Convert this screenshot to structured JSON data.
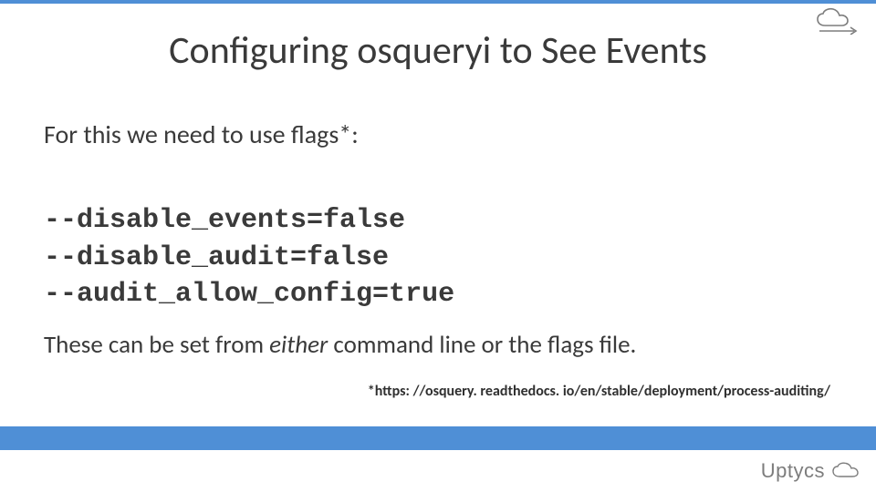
{
  "slide": {
    "title": "Configuring osqueryi to See Events",
    "intro": "For this we need to use flags*:",
    "flags": [
      "--disable_events=false",
      "--disable_audit=false",
      "--audit_allow_config=true"
    ],
    "outro_pre": "These can be set from ",
    "outro_em": "either",
    "outro_post": " command line or the flags file.",
    "footnote": "*https: //osquery. readthedocs. io/en/stable/deployment/process-auditing/",
    "brand": "Uptycs"
  },
  "colors": {
    "accent": "#4f8fd6",
    "text": "#3a3a3a",
    "brand_gray": "#7d7d7d"
  }
}
